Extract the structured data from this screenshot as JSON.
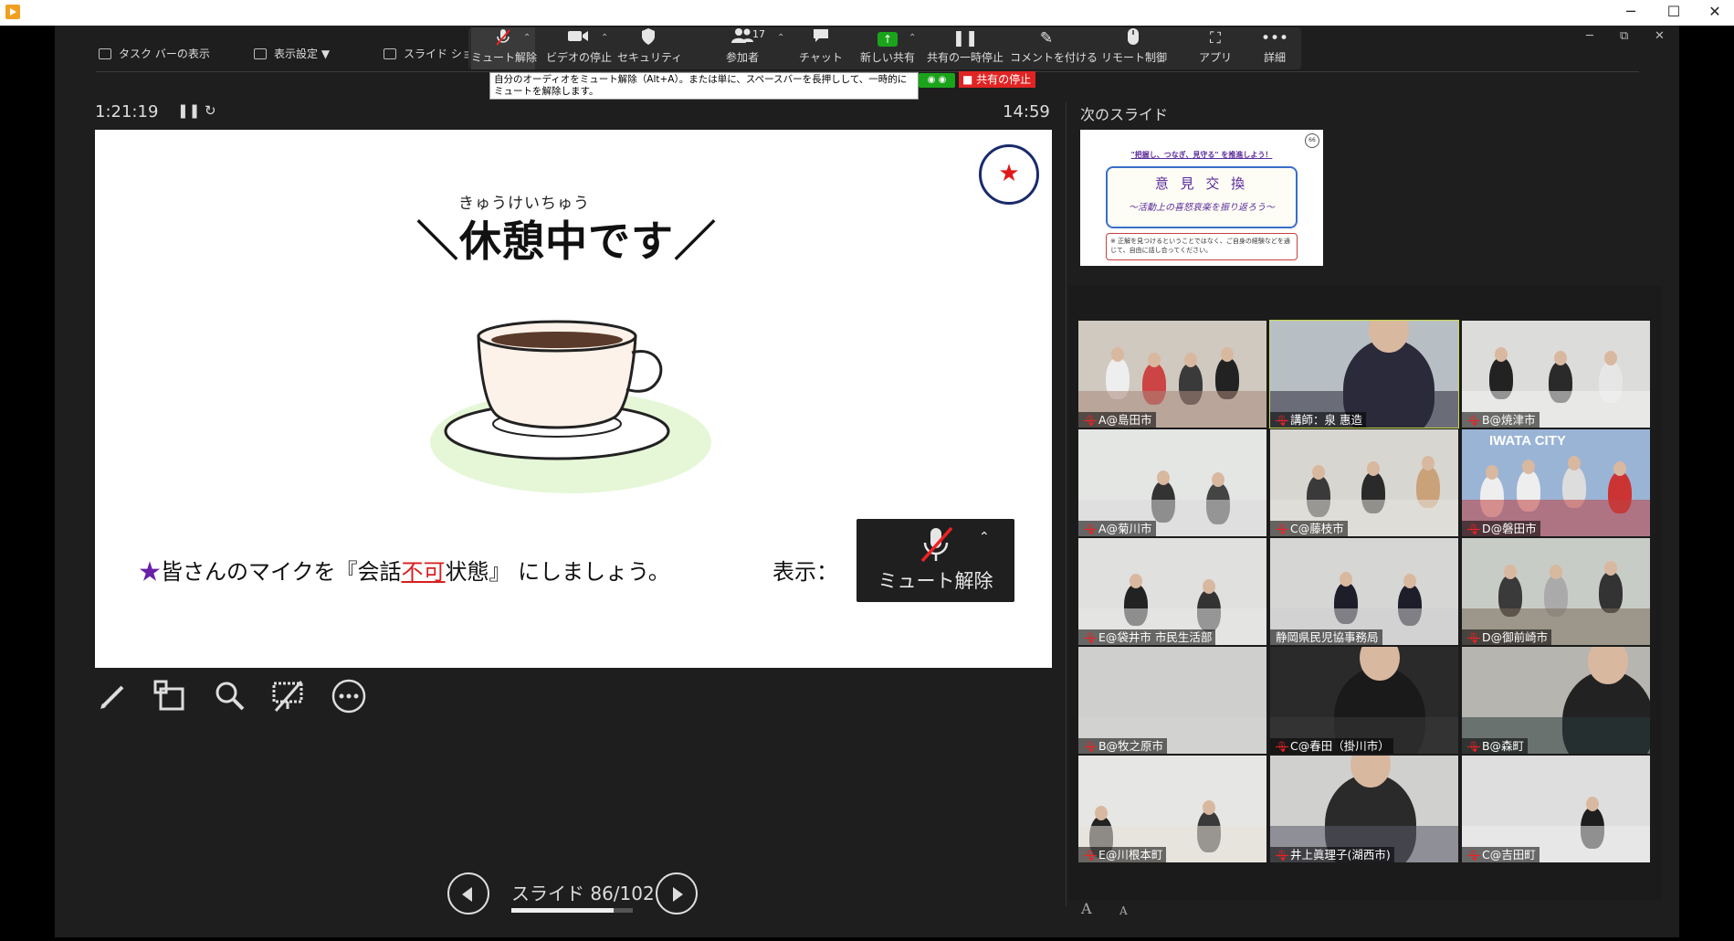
{
  "window": {
    "minimize": "─",
    "maximize": "☐",
    "close": "✕"
  },
  "toolbar_left": {
    "taskbar": "タスク バーの表示",
    "display": "表示設定 ▼",
    "slideshow": "スライド ショ"
  },
  "toolbar": {
    "unmute": "ミュート解除",
    "video_stop": "ビデオの停止",
    "security": "セキュリティ",
    "participants": "参加者",
    "participants_count": "17",
    "chat": "チャット",
    "new_share": "新しい共有",
    "pause_share": "共有の一時停止",
    "annotate": "コメントを付ける",
    "remote_control": "リモート制御",
    "apps": "アプリ",
    "more": "詳細"
  },
  "tooltip": "自分のオーディオをミュート解除（Alt+A）。または単に、スペースバーを長押しして、一時的にミュートを解除します。",
  "stop_share": "■ 共有の停止",
  "presenter": {
    "elapsed": "1:21:19",
    "clock": "14:59",
    "next_slide_label": "次のスライド",
    "slide_counter": "スライド 86/102",
    "progress": 0.843
  },
  "slide": {
    "ruby": "きゅうけいちゅう",
    "title": "＼休憩中です／",
    "star_badge": "★",
    "body_star": "★",
    "body_pre": "皆さんのマイクを『会話",
    "body_red": "不可",
    "body_post": "状態』 にしましょう。",
    "display_label": "表示：",
    "mute_label": "ミュート解除"
  },
  "next_slide": {
    "header": "\"把握し、つなぎ、見守る\" を推進しよう！",
    "title": "意 見 交 換",
    "subtitle": "〜活動上の喜怒哀楽を振り返ろう〜",
    "note": "※ 正解を見つけるということではなく、ご自身の経験などを通じて、自由に話し合ってください。",
    "badge": "66"
  },
  "participants": [
    {
      "name": "A@島田市",
      "muted": true
    },
    {
      "name": "講師：泉 惠造",
      "muted": true
    },
    {
      "name": "B@焼津市",
      "muted": true
    },
    {
      "name": "A@菊川市",
      "muted": true
    },
    {
      "name": "C@藤枝市",
      "muted": true
    },
    {
      "name": "D@磐田市",
      "muted": true
    },
    {
      "name": "E@袋井市 市民生活部",
      "muted": true
    },
    {
      "name": "静岡県民児協事務局",
      "muted": false
    },
    {
      "name": "D@御前崎市",
      "muted": true
    },
    {
      "name": "B@牧之原市",
      "muted": true
    },
    {
      "name": "C@春田（掛川市）",
      "muted": true
    },
    {
      "name": "B@森町",
      "muted": true
    },
    {
      "name": "E@川根本町",
      "muted": true
    },
    {
      "name": "井上眞理子(湖西市)",
      "muted": true
    },
    {
      "name": "C@吉田町",
      "muted": true
    }
  ],
  "iwata_sign": "IWATA CITY",
  "font_controls": {
    "larger": "A",
    "smaller": "A"
  },
  "colors": {
    "share_green": "#1ba31b",
    "stop_red": "#e02424",
    "accent_star": "#e01818"
  }
}
